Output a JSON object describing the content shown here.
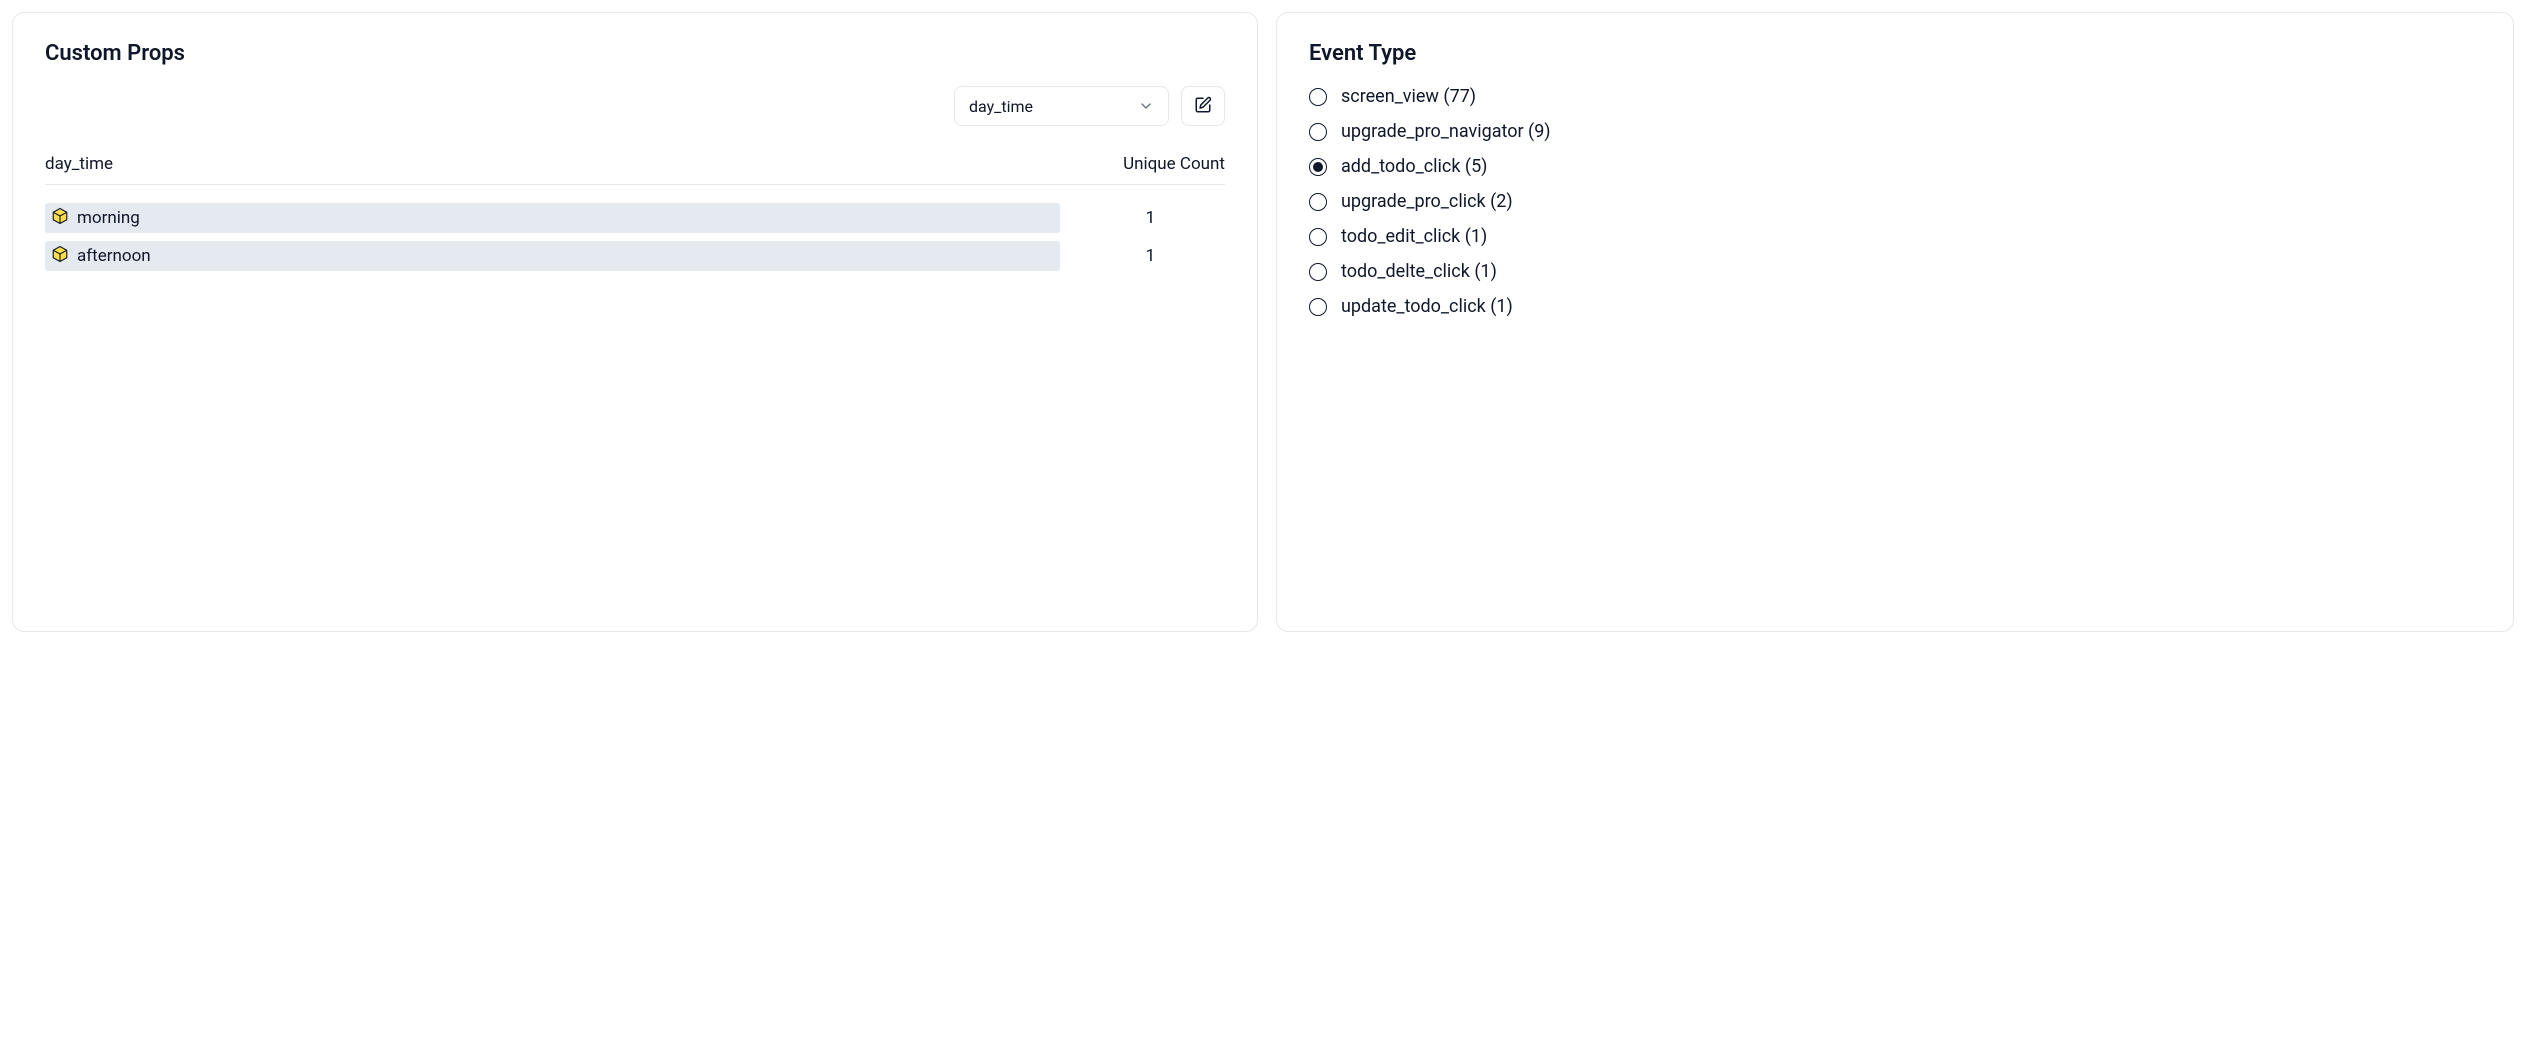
{
  "custom_props": {
    "title": "Custom Props",
    "select_value": "day_time",
    "columns": {
      "prop": "day_time",
      "count": "Unique Count"
    },
    "rows": [
      {
        "label": "morning",
        "count": "1"
      },
      {
        "label": "afternoon",
        "count": "1"
      }
    ]
  },
  "event_type": {
    "title": "Event Type",
    "items": [
      {
        "label": "screen_view (77)",
        "selected": false
      },
      {
        "label": "upgrade_pro_navigator (9)",
        "selected": false
      },
      {
        "label": "add_todo_click (5)",
        "selected": true
      },
      {
        "label": "upgrade_pro_click (2)",
        "selected": false
      },
      {
        "label": "todo_edit_click (1)",
        "selected": false
      },
      {
        "label": "todo_delte_click (1)",
        "selected": false
      },
      {
        "label": "update_todo_click (1)",
        "selected": false
      }
    ]
  }
}
